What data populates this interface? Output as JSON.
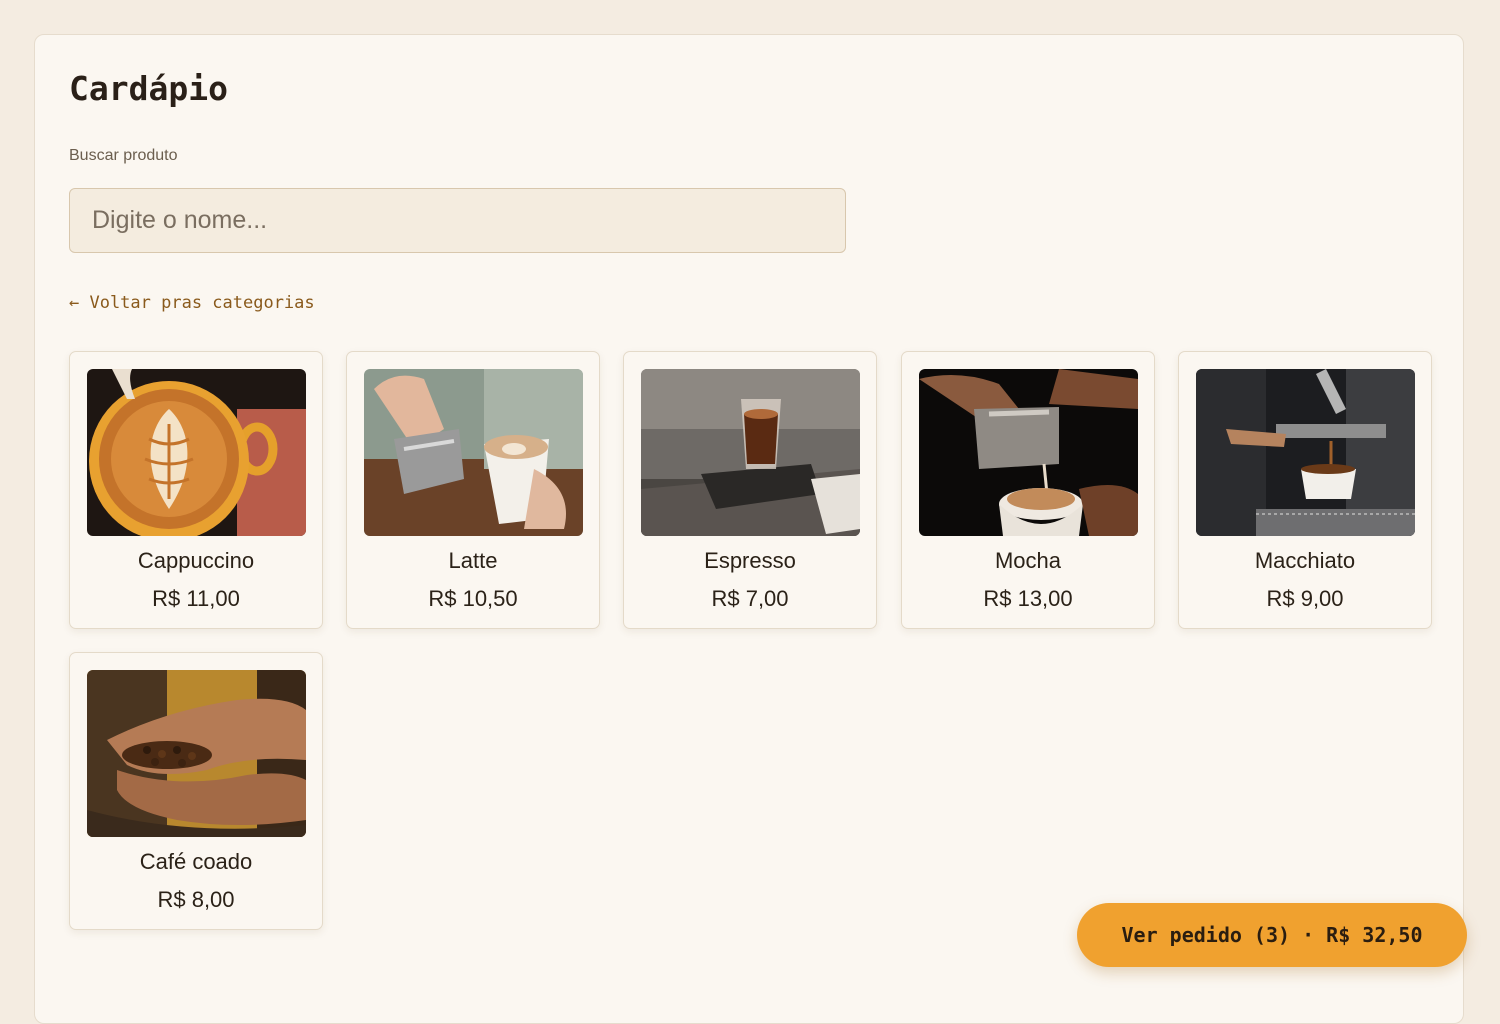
{
  "page": {
    "title": "Cardápio"
  },
  "search": {
    "label": "Buscar produto",
    "placeholder": "Digite o nome...",
    "value": ""
  },
  "navigation": {
    "back_label": "← Voltar pras categorias"
  },
  "products": [
    {
      "name": "Cappuccino",
      "price": "R$ 11,00",
      "image_icon": "cappuccino-latte-art-photo"
    },
    {
      "name": "Latte",
      "price": "R$ 10,50",
      "image_icon": "latte-pour-photo"
    },
    {
      "name": "Espresso",
      "price": "R$ 7,00",
      "image_icon": "espresso-glass-photo"
    },
    {
      "name": "Mocha",
      "price": "R$ 13,00",
      "image_icon": "mocha-pour-photo"
    },
    {
      "name": "Macchiato",
      "price": "R$ 9,00",
      "image_icon": "macchiato-machine-photo"
    },
    {
      "name": "Café coado",
      "price": "R$ 8,00",
      "image_icon": "coffee-beans-hands-photo"
    }
  ],
  "order_button": {
    "label": "Ver pedido (3) · R$ 32,50"
  },
  "colors": {
    "background": "#f4ece1",
    "panel": "#fbf7f1",
    "accent": "#f0a12f",
    "link": "#8a5a1c",
    "text": "#2b2218"
  }
}
